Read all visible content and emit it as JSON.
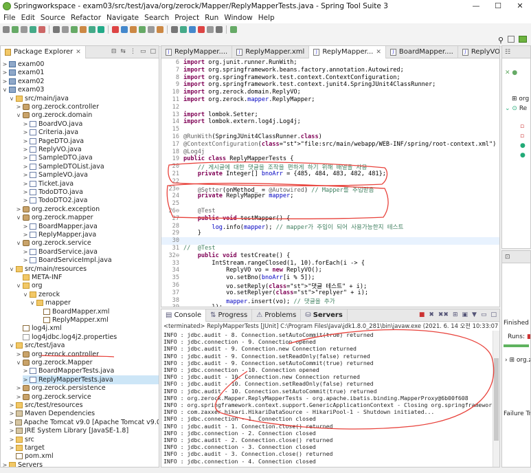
{
  "window": {
    "title": "Springworkspace - exam03/src/test/java/org/zerock/Mapper/ReplyMapperTests.java - Spring Tool Suite 3",
    "controls": [
      "—",
      "☐",
      "✕"
    ]
  },
  "menu": [
    "File",
    "Edit",
    "Source",
    "Refactor",
    "Navigate",
    "Search",
    "Project",
    "Run",
    "Window",
    "Help"
  ],
  "package_explorer": {
    "tab_label": "Package Explorer",
    "tree": [
      {
        "label": "exam00",
        "icon": "project",
        "depth": 0,
        "twisty": ">"
      },
      {
        "label": "exam01",
        "icon": "project",
        "depth": 0,
        "twisty": ">"
      },
      {
        "label": "exam02",
        "icon": "project",
        "depth": 0,
        "twisty": ">"
      },
      {
        "label": "exam03",
        "icon": "project",
        "depth": 0,
        "twisty": "v"
      },
      {
        "label": "src/main/java",
        "icon": "folder",
        "depth": 1,
        "twisty": "v"
      },
      {
        "label": "org.zerock.controller",
        "icon": "package",
        "depth": 2,
        "twisty": ">"
      },
      {
        "label": "org.zerock.domain",
        "icon": "package",
        "depth": 2,
        "twisty": "v"
      },
      {
        "label": "BoardVO.java",
        "icon": "java",
        "depth": 3,
        "twisty": ">"
      },
      {
        "label": "Criteria.java",
        "icon": "java",
        "depth": 3,
        "twisty": ">"
      },
      {
        "label": "PageDTO.java",
        "icon": "java",
        "depth": 3,
        "twisty": ">"
      },
      {
        "label": "ReplyVO.java",
        "icon": "java",
        "depth": 3,
        "twisty": ">"
      },
      {
        "label": "SampleDTO.java",
        "icon": "java",
        "depth": 3,
        "twisty": ">"
      },
      {
        "label": "SampleDTOList.java",
        "icon": "java",
        "depth": 3,
        "twisty": ">"
      },
      {
        "label": "SampleVO.java",
        "icon": "java",
        "depth": 3,
        "twisty": ">"
      },
      {
        "label": "Ticket.java",
        "icon": "java",
        "depth": 3,
        "twisty": ">"
      },
      {
        "label": "TodoDTO.java",
        "icon": "java",
        "depth": 3,
        "twisty": ">"
      },
      {
        "label": "TodoDTO2.java",
        "icon": "java",
        "depth": 3,
        "twisty": ">"
      },
      {
        "label": "org.zerock.exception",
        "icon": "package",
        "depth": 2,
        "twisty": ">"
      },
      {
        "label": "org.zerock.mapper",
        "icon": "package",
        "depth": 2,
        "twisty": "v"
      },
      {
        "label": "BoardMapper.java",
        "icon": "java",
        "depth": 3,
        "twisty": ">"
      },
      {
        "label": "ReplyMapper.java",
        "icon": "java",
        "depth": 3,
        "twisty": ">"
      },
      {
        "label": "org.zerock.service",
        "icon": "package",
        "depth": 2,
        "twisty": "v"
      },
      {
        "label": "BoardService.java",
        "icon": "java",
        "depth": 3,
        "twisty": ">"
      },
      {
        "label": "BoardServiceImpl.java",
        "icon": "java",
        "depth": 3,
        "twisty": ">"
      },
      {
        "label": "src/main/resources",
        "icon": "folder",
        "depth": 1,
        "twisty": "v"
      },
      {
        "label": "META-INF",
        "icon": "folder",
        "depth": 2,
        "twisty": ""
      },
      {
        "label": "org",
        "icon": "folder",
        "depth": 2,
        "twisty": "v"
      },
      {
        "label": "zerock",
        "icon": "folder",
        "depth": 3,
        "twisty": "v"
      },
      {
        "label": "mapper",
        "icon": "folder",
        "depth": 4,
        "twisty": "v"
      },
      {
        "label": "BoardMapper.xml",
        "icon": "xml",
        "depth": 5,
        "twisty": ""
      },
      {
        "label": "ReplyMapper.xml",
        "icon": "xml",
        "depth": 5,
        "twisty": ""
      },
      {
        "label": "log4j.xml",
        "icon": "xml",
        "depth": 2,
        "twisty": ""
      },
      {
        "label": "log4jdbc.log4j2.properties",
        "icon": "file",
        "depth": 2,
        "twisty": ""
      },
      {
        "label": "src/test/java",
        "icon": "folder",
        "depth": 1,
        "twisty": "v"
      },
      {
        "label": "org.zerock.controller",
        "icon": "package",
        "depth": 2,
        "twisty": ">"
      },
      {
        "label": "org.zerock.Mapper",
        "icon": "package",
        "depth": 2,
        "twisty": "v"
      },
      {
        "label": "BoardMapperTests.java",
        "icon": "java",
        "depth": 3,
        "twisty": ">"
      },
      {
        "label": "ReplyMapperTests.java",
        "icon": "java",
        "depth": 3,
        "twisty": ">",
        "selected": true
      },
      {
        "label": "org.zerock.persistence",
        "icon": "package",
        "depth": 2,
        "twisty": ">"
      },
      {
        "label": "org.zerock.service",
        "icon": "package",
        "depth": 2,
        "twisty": ">"
      },
      {
        "label": "src/test/resources",
        "icon": "folder",
        "depth": 1,
        "twisty": ">"
      },
      {
        "label": "Maven Dependencies",
        "icon": "library",
        "depth": 1,
        "twisty": ">"
      },
      {
        "label": "Apache Tomcat v9.0 [Apache Tomcat v9.0]",
        "icon": "library",
        "depth": 1,
        "twisty": ">"
      },
      {
        "label": "JRE System Library [JavaSE-1.8]",
        "icon": "library",
        "depth": 1,
        "twisty": ">"
      },
      {
        "label": "src",
        "icon": "folder",
        "depth": 1,
        "twisty": ">"
      },
      {
        "label": "target",
        "icon": "folder",
        "depth": 1,
        "twisty": ">"
      },
      {
        "label": "pom.xml",
        "icon": "xml",
        "depth": 1,
        "twisty": ""
      },
      {
        "label": "Servers",
        "icon": "folder",
        "depth": 0,
        "twisty": ">"
      }
    ]
  },
  "editor": {
    "tabs": [
      {
        "label": "ReplyMapper....",
        "active": false
      },
      {
        "label": "ReplyMapper.xml",
        "active": false
      },
      {
        "label": "ReplyMapper...",
        "active": true
      },
      {
        "label": "BoardMapper....",
        "active": false
      },
      {
        "label": "ReplyVO.java",
        "active": false
      }
    ],
    "overflow": "»₁",
    "lines": [
      {
        "n": "6",
        "t": "import org.junit.runner.RunWith;"
      },
      {
        "n": "7",
        "t": "import org.springframework.beans.factory.annotation.Autowired;"
      },
      {
        "n": "8",
        "t": "import org.springframework.test.context.ContextConfiguration;"
      },
      {
        "n": "9",
        "t": "import org.springframework.test.context.junit4.SpringJUnit4ClassRunner;"
      },
      {
        "n": "10",
        "t": "import org.zerock.domain.ReplyVO;"
      },
      {
        "n": "11",
        "t": "import org.zerock.mapper.ReplyMapper;"
      },
      {
        "n": "12",
        "t": ""
      },
      {
        "n": "13",
        "t": "import lombok.Setter;"
      },
      {
        "n": "14",
        "t": "import lombok.extern.log4j.Log4j;"
      },
      {
        "n": "15",
        "t": ""
      },
      {
        "n": "16",
        "t": "@RunWith(SpringJUnit4ClassRunner.class)"
      },
      {
        "n": "17",
        "t": "@ContextConfiguration(\"file:src/main/webapp/WEB-INF/spring/root-context.xml\")"
      },
      {
        "n": "18",
        "t": "@Log4j"
      },
      {
        "n": "19",
        "t": "public class ReplyMapperTests {"
      },
      {
        "n": "20",
        "t": "    // 게시글에 대한 댓글을 조작을 편하게 하기 위해 배열을 사용"
      },
      {
        "n": "21",
        "t": "    private Integer[] bnoArr = {485, 484, 483, 482, 481};"
      },
      {
        "n": "22",
        "t": ""
      },
      {
        "n": "23⊖",
        "t": "    @Setter(onMethod_ = @Autowired) // Mapper를 주입받음"
      },
      {
        "n": "24",
        "t": "    private ReplyMapper mapper;"
      },
      {
        "n": "25",
        "t": ""
      },
      {
        "n": "26⊖",
        "t": "    @Test"
      },
      {
        "n": "27",
        "t": "    public void testMapper() {"
      },
      {
        "n": "28",
        "t": "        log.info(mapper); // mapper가 주입이 되어 사용가능한지 테스트"
      },
      {
        "n": "29",
        "t": "    }"
      },
      {
        "n": "30",
        "t": ""
      },
      {
        "n": "31",
        "t": "//  @Test"
      },
      {
        "n": "32⊖",
        "t": "    public void testCreate() {"
      },
      {
        "n": "33",
        "t": "        IntStream.rangeClosed(1, 10).forEach(i -> {"
      },
      {
        "n": "34",
        "t": "            ReplyVO vo = new ReplyVO();"
      },
      {
        "n": "35",
        "t": "            vo.setBno(bnoArr[i % 5]);"
      },
      {
        "n": "36",
        "t": "            vo.setReply(\"댓글 테스트\" + i);"
      },
      {
        "n": "37",
        "t": "            vo.setReplyer(\"replyer\" + i);"
      },
      {
        "n": "38",
        "t": "            mapper.insert(vo); // 댓글을 추가"
      },
      {
        "n": "39",
        "t": "        });"
      },
      {
        "n": "40",
        "t": "    }"
      },
      {
        "n": "41",
        "t": "}"
      },
      {
        "n": "42",
        "t": ""
      }
    ]
  },
  "console": {
    "tabs": [
      "Console",
      "Progress",
      "Problems",
      "Servers"
    ],
    "terminated": "<terminated> ReplyMapperTests [JUnit] C:\\Program Files\\Java\\jdk1.8.0_281\\bin\\javaw.exe  (2021. 6. 14 오전 10:33:07 – 오전 10:33:10)",
    "lines": [
      "INFO : jdbc.audit - 8. Connection.setAutoCommit(true) returned",
      "INFO : jdbc.connection - 9. Connection opened",
      "INFO : jdbc.audit - 9. Connection.new Connection returned",
      "INFO : jdbc.audit - 9. Connection.setReadOnly(false) returned",
      "INFO : jdbc.audit - 9. Connection.setAutoCommit(true) returned",
      "INFO : jdbc.connection - 10. Connection opened",
      "INFO : jdbc.audit - 10. Connection.new Connection returned",
      "INFO : jdbc.audit - 10. Connection.setReadOnly(false) returned",
      "INFO : jdbc.audit - 10. Connection.setAutoCommit(true) returned",
      "INFO : org.zerock.Mapper.ReplyMapperTests - org.apache.ibatis.binding.MapperProxy@6b00f608",
      "INFO : org.springframework.context.support.GenericApplicationContext - Closing org.springframework.context",
      "INFO : com.zaxxer.hikari.HikariDataSource - HikariPool-1 - Shutdown initiated...",
      "INFO : jdbc.connection - 1. Connection closed",
      "INFO : jdbc.audit - 1. Connection.close() returned",
      "INFO : jdbc.connection - 2. Connection closed",
      "INFO : jdbc.audit - 2. Connection.close() returned",
      "INFO : jdbc.connection - 3. Connection closed",
      "INFO : jdbc.audit - 3. Connection.close() returned",
      "INFO : jdbc.connection - 4. Connection closed"
    ]
  },
  "right_panel": {
    "outline_items": [
      "org",
      "Re"
    ],
    "junit_status": "Finished afte",
    "runs_label": "Runs:",
    "tree_item": "org.z",
    "failure_label": "Failure Trac"
  },
  "colors": {
    "annotation_red": "#e8413a",
    "selection": "#cde6f7",
    "keyword": "#7f0055",
    "string": "#2a00ff",
    "comment": "#3f7f5f"
  }
}
